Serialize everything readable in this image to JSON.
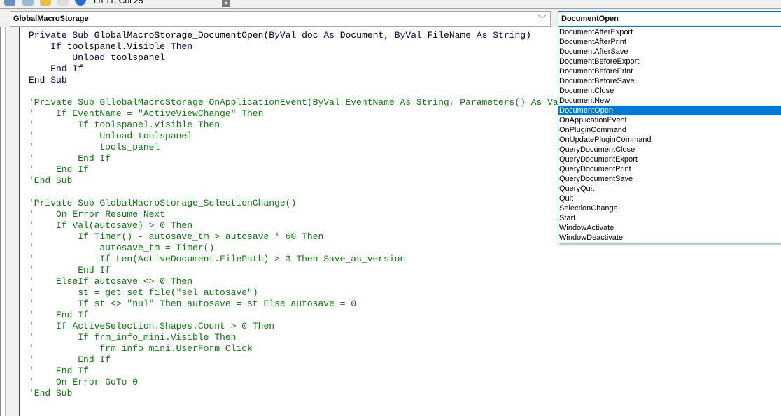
{
  "toolbar": {
    "status": "Ln 11, Col 25",
    "icons": [
      "view-object-icon",
      "properties-icon",
      "project-icon",
      "toolbox-icon",
      "help-icon"
    ]
  },
  "object_combo": {
    "value": "GlobalMacroStorage"
  },
  "procedure_combo": {
    "value": "DocumentOpen",
    "selected_index": 8,
    "options": [
      "DocumentAfterExport",
      "DocumentAfterPrint",
      "DocumentAfterSave",
      "DocumentBeforeExport",
      "DocumentBeforePrint",
      "DocumentBeforeSave",
      "DocumentClose",
      "DocumentNew",
      "DocumentOpen",
      "OnApplicationEvent",
      "OnPluginCommand",
      "OnUpdatePluginCommand",
      "QueryDocumentClose",
      "QueryDocumentExport",
      "QueryDocumentPrint",
      "QueryDocumentSave",
      "QueryQuit",
      "Quit",
      "SelectionChange",
      "Start",
      "WindowActivate",
      "WindowDeactivate"
    ]
  },
  "colors": {
    "keyword": "#00007f",
    "comment": "#008000",
    "selection": "#0078d7"
  },
  "code": {
    "lines": [
      "Private Sub GlobalMacroStorage_DocumentOpen(ByVal doc As Document, ByVal FileName As String)",
      "    If toolspanel.Visible Then",
      "        Unload toolspanel",
      "    End If",
      "End Sub",
      "",
      "'Private Sub GllobalMacroStorage_OnApplicationEvent(ByVal EventName As String, Parameters() As Variant)",
      "'    If EventName = \"ActiveViewChange\" Then",
      "'        If toolspanel.Visible Then",
      "'            Unload toolspanel",
      "'            tools_panel",
      "'        End If",
      "'    End If",
      "'End Sub",
      "",
      "'Private Sub GlobalMacroStorage_SelectionChange()",
      "'    On Error Resume Next",
      "'    If Val(autosave) > 0 Then",
      "'        If Timer() - autosave_tm > autosave * 60 Then",
      "'            autosave_tm = Timer()",
      "'            If Len(ActiveDocument.FilePath) > 3 Then Save_as_version",
      "'        End If",
      "'    ElseIf autosave <> 0 Then",
      "'        st = get_set_file(\"sel_autosave\")",
      "'        If st <> \"nul\" Then autosave = st Else autosave = 0",
      "'    End If",
      "'    If ActiveSelection.Shapes.Count > 0 Then",
      "'        If frm_info_mini.Visible Then",
      "'            frm_info_mini.UserForm_Click",
      "'        End If",
      "'    End If",
      "'    On Error GoTo 0",
      "'End Sub"
    ]
  }
}
